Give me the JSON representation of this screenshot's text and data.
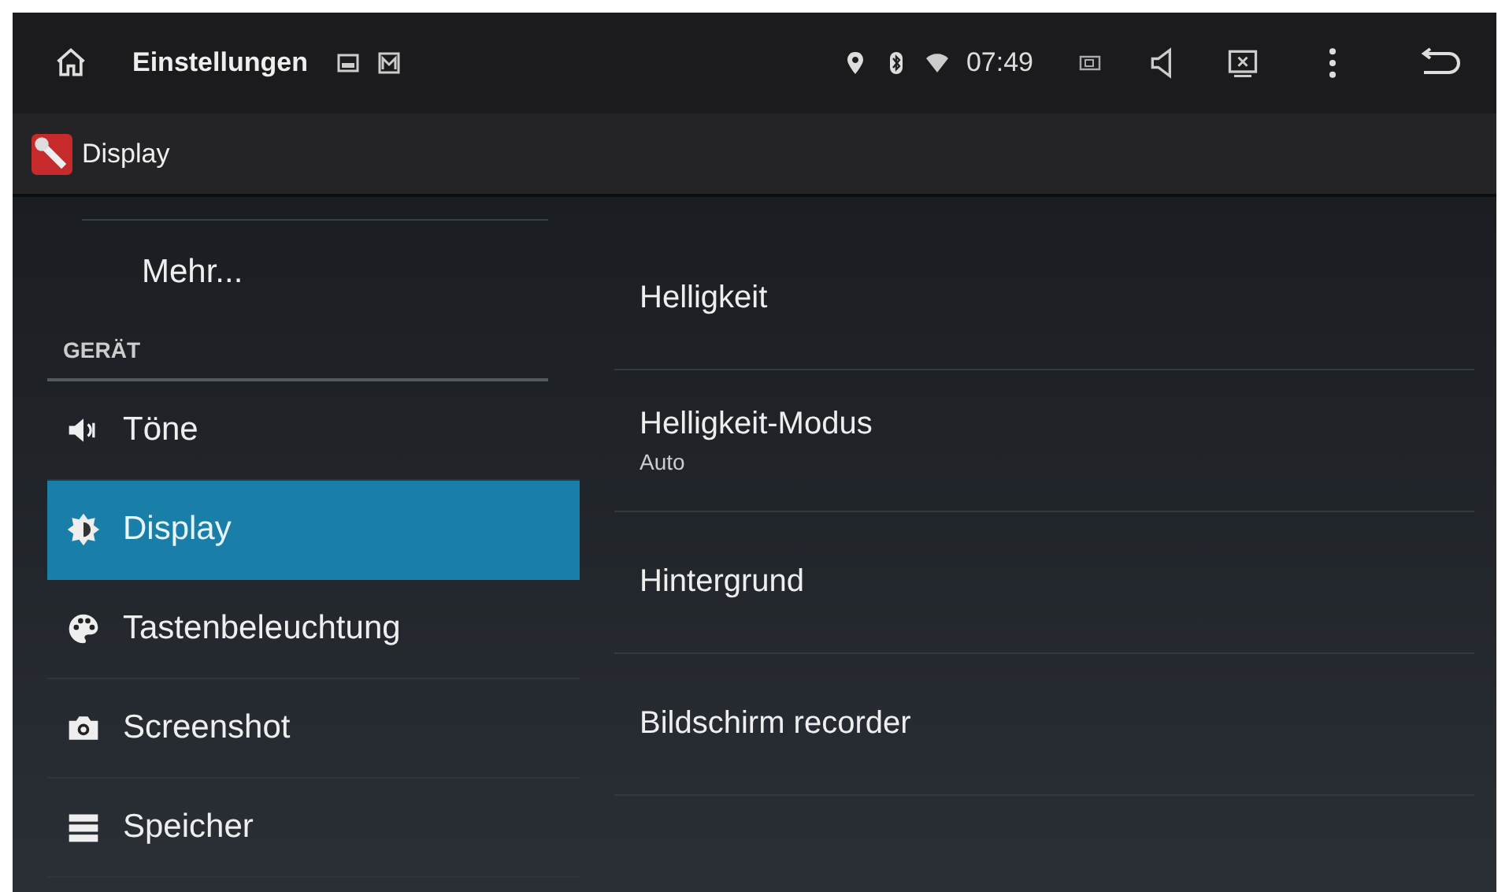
{
  "status_bar": {
    "app_name": "Einstellungen",
    "time": "07:49"
  },
  "title_bar": {
    "title": "Display"
  },
  "sidebar": {
    "items": [
      {
        "kind": "link",
        "label": "Mehr...",
        "selected": false
      },
      {
        "kind": "header",
        "label": "GERÄT"
      },
      {
        "kind": "item",
        "label": "Töne",
        "selected": false
      },
      {
        "kind": "item",
        "label": "Display",
        "selected": true
      },
      {
        "kind": "item",
        "label": "Tastenbeleuchtung",
        "selected": false
      },
      {
        "kind": "item",
        "label": "Screenshot",
        "selected": false
      },
      {
        "kind": "item",
        "label": "Speicher",
        "selected": false
      }
    ]
  },
  "settings": [
    {
      "title": "Helligkeit"
    },
    {
      "title": "Helligkeit-Modus",
      "summary": "Auto"
    },
    {
      "title": "Hintergrund"
    },
    {
      "title": "Bildschirm recorder"
    }
  ]
}
